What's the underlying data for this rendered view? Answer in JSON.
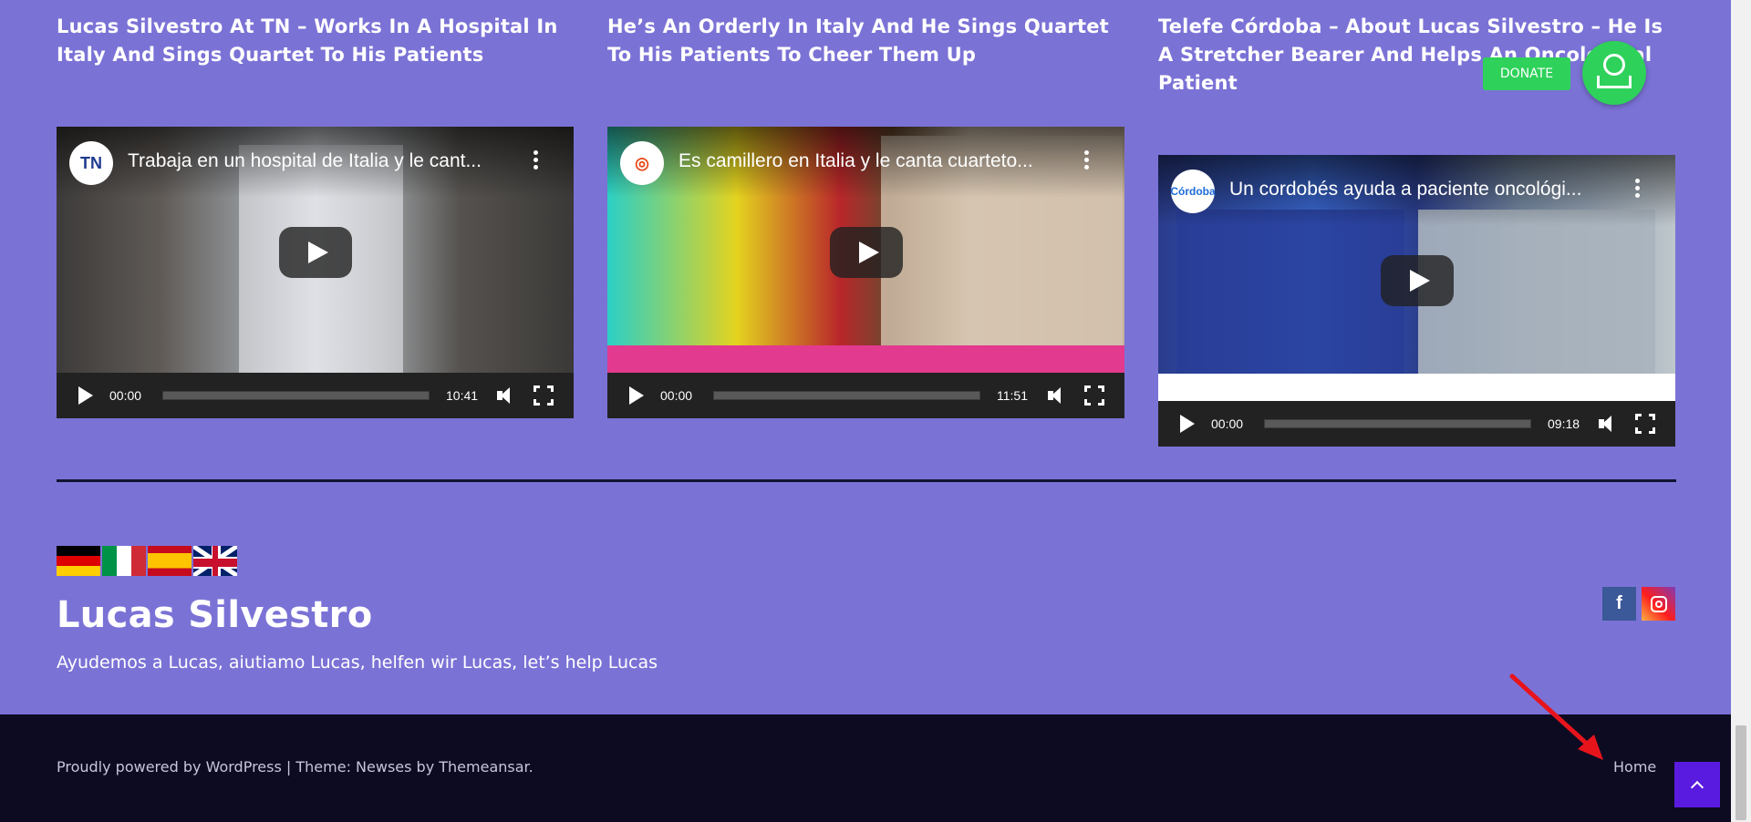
{
  "posts": [
    {
      "title": "Lucas Silvestro At TN – Works In A Hospital In Italy And Sings Quartet To His Patients",
      "video": {
        "channel_logo": "TN",
        "title": "Trabaja en un hospital de Italia y le cant...",
        "current_time": "00:00",
        "duration": "10:41"
      }
    },
    {
      "title": "He’s An Orderly In Italy And He Sings Quartet To His Patients To Cheer Them Up",
      "video": {
        "channel_logo": "◎",
        "title": "Es camillero en Italia y le canta cuarteto...",
        "current_time": "00:00",
        "duration": "11:51"
      }
    },
    {
      "title": "Telefe Córdoba – About Lucas Silvestro – He Is A Stretcher Bearer And Helps An Oncological Patient",
      "video": {
        "channel_logo": "Córdoba",
        "title": "Un cordobés ayuda a paciente oncológi...",
        "current_time": "00:00",
        "duration": "09:18"
      }
    }
  ],
  "donate": {
    "label": "DONATE",
    "icon": "donate-hand-coin-icon",
    "color": "#2ed15a"
  },
  "footer": {
    "languages": [
      "German",
      "Italian",
      "Spanish",
      "English"
    ],
    "site_title": "Lucas Silvestro",
    "tagline": "Ayudemos a Lucas, aiutiamo Lucas, helfen wir Lucas, let’s help Lucas",
    "social": {
      "facebook_glyph": "f",
      "instagram": "instagram-icon"
    },
    "credits_prefix": "Proudly powered by WordPress",
    "credits_sep": " | Theme: Newses by ",
    "credits_theme_author": "Themeansar",
    "credits_suffix": ".",
    "home_link": "Home"
  },
  "colors": {
    "background": "#7b72d6",
    "footer_bar": "#0d0b22",
    "accent": "#5a1be0",
    "annotation_arrow": "#e8141c"
  }
}
